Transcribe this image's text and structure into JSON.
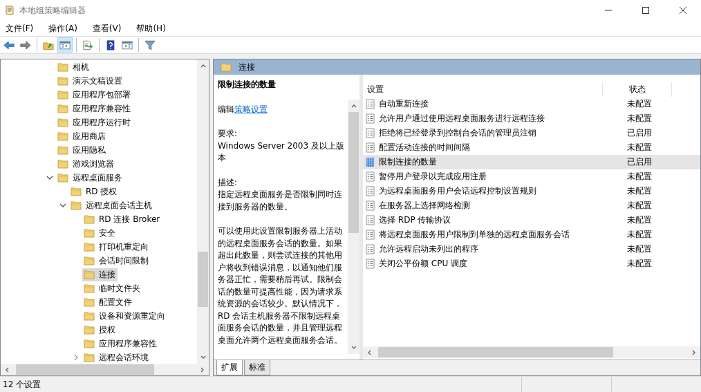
{
  "window": {
    "title": "本地组策略编辑器"
  },
  "menu": [
    {
      "label": "文件(F)"
    },
    {
      "label": "操作(A)"
    },
    {
      "label": "查看(V)"
    },
    {
      "label": "帮助(H)"
    }
  ],
  "toolbar": [
    {
      "kind": "back",
      "pressed": false
    },
    {
      "kind": "forward",
      "pressed": false
    },
    {
      "kind": "sep"
    },
    {
      "kind": "up",
      "pressed": false
    },
    {
      "kind": "tree",
      "pressed": true
    },
    {
      "kind": "sep"
    },
    {
      "kind": "export",
      "pressed": false
    },
    {
      "kind": "sep"
    },
    {
      "kind": "help",
      "pressed": false
    },
    {
      "kind": "pane",
      "pressed": false
    },
    {
      "kind": "sep"
    },
    {
      "kind": "filter",
      "pressed": false
    }
  ],
  "tree": [
    {
      "label": "相机",
      "selected": false
    },
    {
      "label": "演示文稿设置",
      "selected": false
    },
    {
      "label": "应用程序包部署",
      "selected": false
    },
    {
      "label": "应用程序兼容性",
      "selected": false
    },
    {
      "label": "应用程序运行时",
      "selected": false
    },
    {
      "label": "应用商店",
      "selected": false
    },
    {
      "label": "应用隐私",
      "selected": false
    },
    {
      "label": "游戏浏览器",
      "selected": false
    },
    {
      "label": "远程桌面服务",
      "selected": false,
      "expanded": true,
      "children": [
        {
          "label": "RD 授权",
          "selected": false
        },
        {
          "label": "远程桌面会话主机",
          "selected": false,
          "expanded": true,
          "children": [
            {
              "label": "RD 连接 Broker",
              "selected": false
            },
            {
              "label": "安全",
              "selected": false
            },
            {
              "label": "打印机重定向",
              "selected": false
            },
            {
              "label": "会话时间限制",
              "selected": false
            },
            {
              "label": "连接",
              "selected": true
            },
            {
              "label": "临时文件夹",
              "selected": false
            },
            {
              "label": "配置文件",
              "selected": false
            },
            {
              "label": "设备和资源重定向",
              "selected": false
            },
            {
              "label": "授权",
              "selected": false
            },
            {
              "label": "应用程序兼容性",
              "selected": false
            },
            {
              "label": "远程会话环境",
              "selected": false,
              "expanded": false
            }
          ]
        }
      ]
    }
  ],
  "folder_header": {
    "title": "连接"
  },
  "description": {
    "title": "限制连接的数量",
    "edit_prefix": "编辑",
    "edit_link": "策略设置",
    "requirement_label": "要求:",
    "requirement": "Windows Server 2003 及以上版本",
    "description_label": "描述:",
    "paragraphs": [
      "指定远程桌面服务是否限制同时连接到服务器的数量。",
      "可以使用此设置限制服务器上活动的远程桌面服务会话的数量。如果超出此数量，则尝试连接的其他用户将收到错误消息，以通知他们服务器正忙，需要稍后再试。限制会话的数量可提高性能，因为请求系统资源的会话较少。默认情况下，RD 会话主机服务器不限制远程桌面服务会话的数量，并且管理远程桌面允许两个远程桌面服务会话。"
    ]
  },
  "view_tabs": [
    {
      "label": "扩展",
      "selected": true
    },
    {
      "label": "标准",
      "selected": false
    }
  ],
  "settings": {
    "columns": [
      "设置",
      "状态"
    ],
    "rows": [
      {
        "name": "自动重新连接",
        "state": "未配置",
        "selected": false
      },
      {
        "name": "允许用户通过使用远程桌面服务进行远程连接",
        "state": "未配置",
        "selected": false
      },
      {
        "name": "拒绝将已经登录到控制台会话的管理员注销",
        "state": "已启用",
        "selected": false
      },
      {
        "name": "配置活动连接的时间间隔",
        "state": "未配置",
        "selected": false
      },
      {
        "name": "限制连接的数量",
        "state": "已启用",
        "selected": true
      },
      {
        "name": "暂停用户登录以完成应用注册",
        "state": "未配置",
        "selected": false
      },
      {
        "name": "为远程桌面服务用户会话远程控制设置规则",
        "state": "未配置",
        "selected": false
      },
      {
        "name": "在服务器上选择网络检测",
        "state": "未配置",
        "selected": false
      },
      {
        "name": "选择 RDP 传输协议",
        "state": "未配置",
        "selected": false
      },
      {
        "name": "将远程桌面服务用户限制到单独的远程桌面服务会话",
        "state": "未配置",
        "selected": false
      },
      {
        "name": "允许远程启动未列出的程序",
        "state": "未配置",
        "selected": false
      },
      {
        "name": "关闭公平份额 CPU 调度",
        "state": "未配置",
        "selected": false
      }
    ]
  },
  "status_bar": {
    "text": "12 个设置"
  }
}
